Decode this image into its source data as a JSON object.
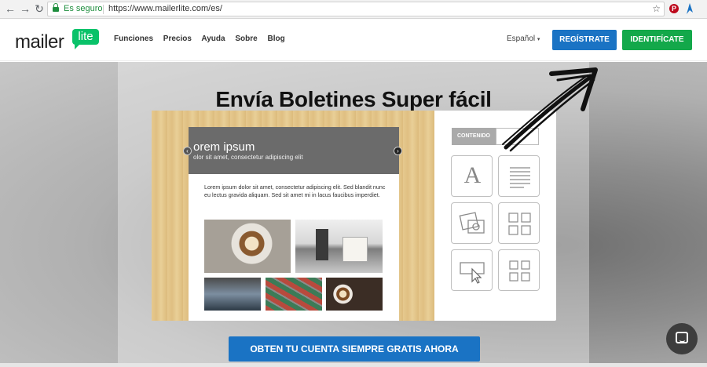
{
  "browser": {
    "secure_label": "Es seguro",
    "url": "https://www.mailerlite.com/es/"
  },
  "header": {
    "logo_text": "mailer",
    "logo_badge": "lite",
    "nav": [
      "Funciones",
      "Precios",
      "Ayuda",
      "Sobre",
      "Blog"
    ],
    "language": "Español",
    "register_label": "REGÍSTRATE",
    "login_label": "IDENTIFÍCATE"
  },
  "hero": {
    "title": "Envía Boletines Super fácil",
    "cta_label": "OBTEN TU CUENTA SIEMPRE GRATIS AHORA"
  },
  "editor": {
    "email_heading": "orem ipsum",
    "email_subheading": "olor sit amet, consectetur adipiscing elit",
    "email_body": "Lorem ipsum dolor sit amet, consectetur adipiscing elit. Sed blandit nunc eu lectus gravida aliquam. Sed sit amet mi in lacus faucibus imperdiet.",
    "panel_tab": "CONTENIDO"
  },
  "colors": {
    "brand_green": "#09c269",
    "register_blue": "#1a73c4",
    "login_green": "#13a84a"
  }
}
